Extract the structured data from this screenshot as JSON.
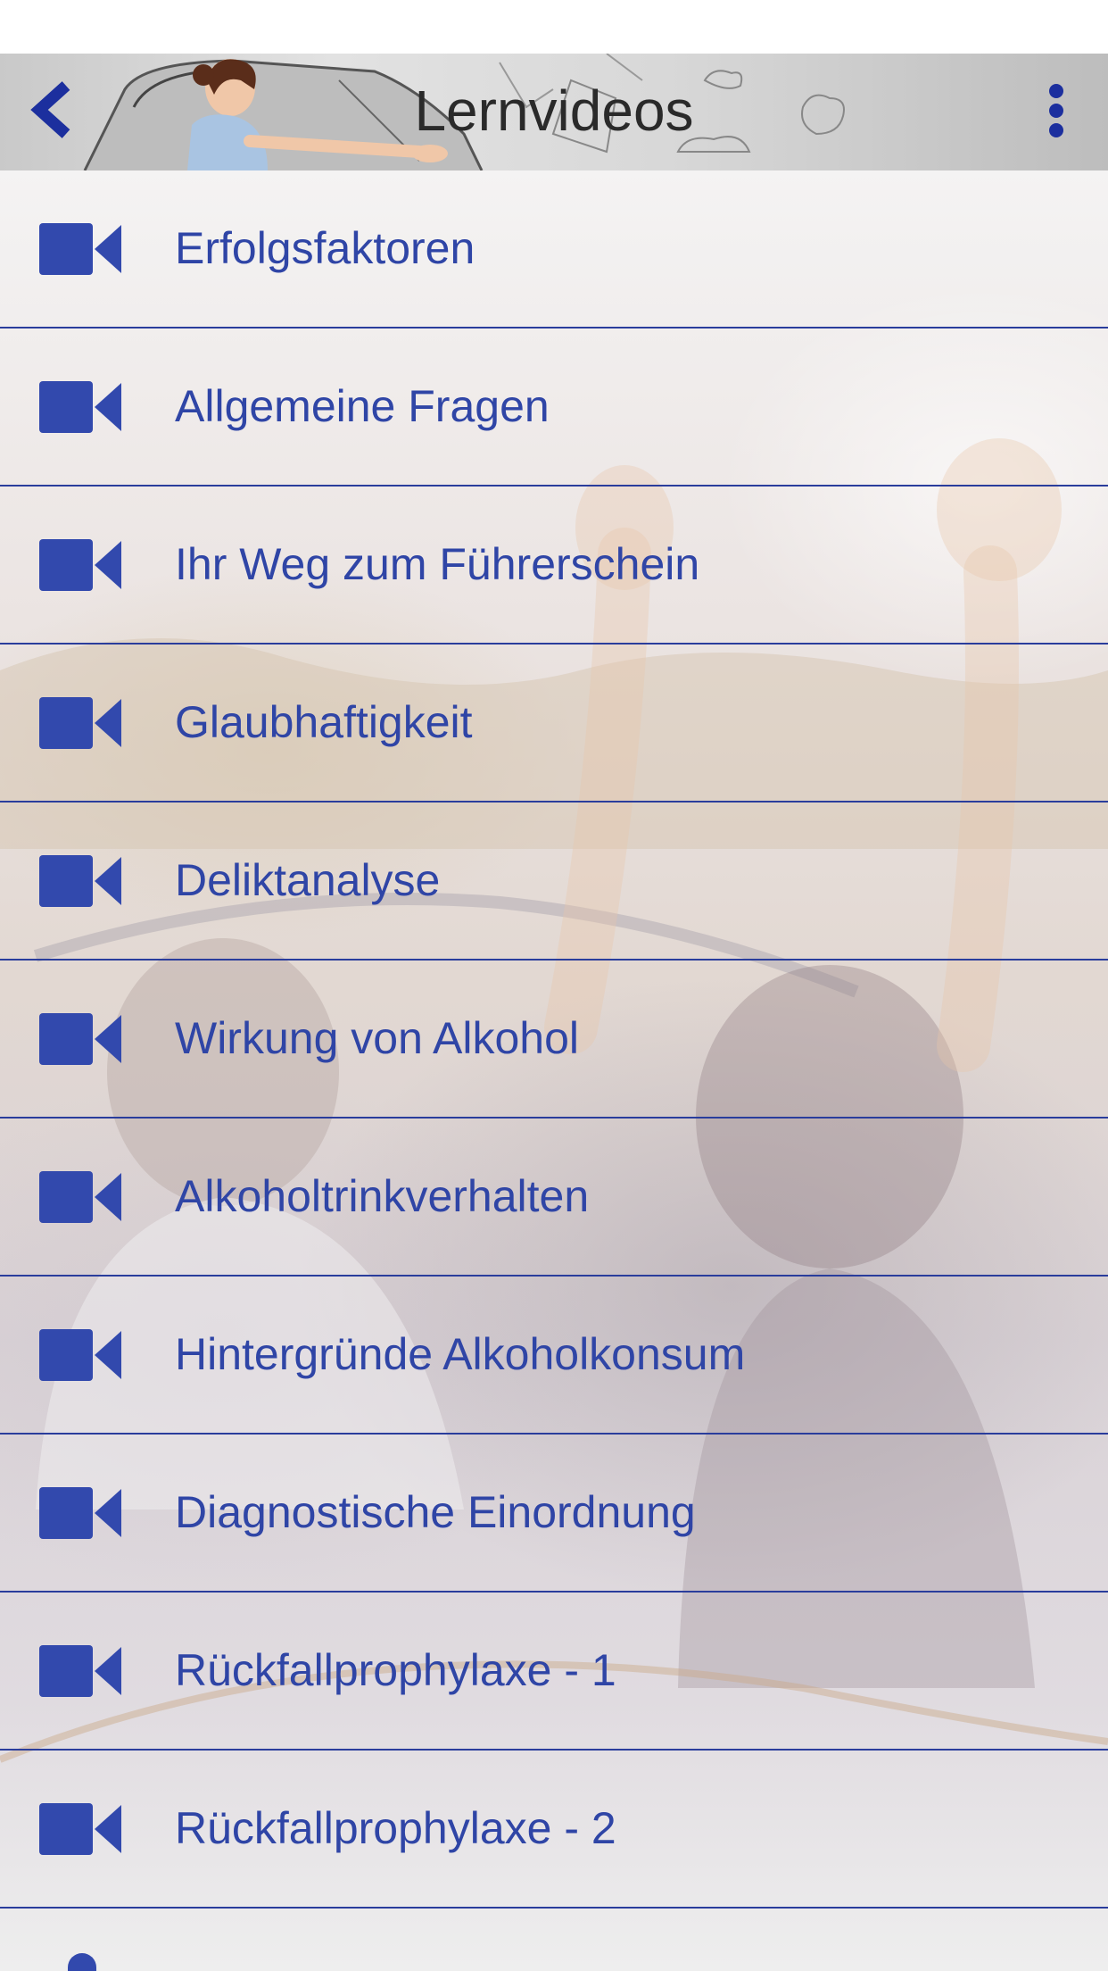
{
  "header": {
    "title": "Lernvideos",
    "back_icon": "chevron-left-icon",
    "menu_icon": "more-vertical-icon"
  },
  "list": {
    "item_icon": "video-camera-icon",
    "items": [
      {
        "label": "Erfolgsfaktoren"
      },
      {
        "label": "Allgemeine Fragen"
      },
      {
        "label": "Ihr Weg zum Führerschein"
      },
      {
        "label": "Glaubhaftigkeit"
      },
      {
        "label": "Deliktanalyse"
      },
      {
        "label": "Wirkung von Alkohol"
      },
      {
        "label": "Alkoholtrinkverhalten"
      },
      {
        "label": "Hintergründe Alkoholkonsum"
      },
      {
        "label": "Diagnostische Einordnung"
      },
      {
        "label": "Rückfallprophylaxe - 1"
      },
      {
        "label": "Rückfallprophylaxe - 2"
      }
    ],
    "partial_item_icon": "microphone-icon"
  },
  "colors": {
    "accent": "#2f45a6",
    "divider": "#2a3d9c",
    "title_text": "#2a2a2a"
  }
}
